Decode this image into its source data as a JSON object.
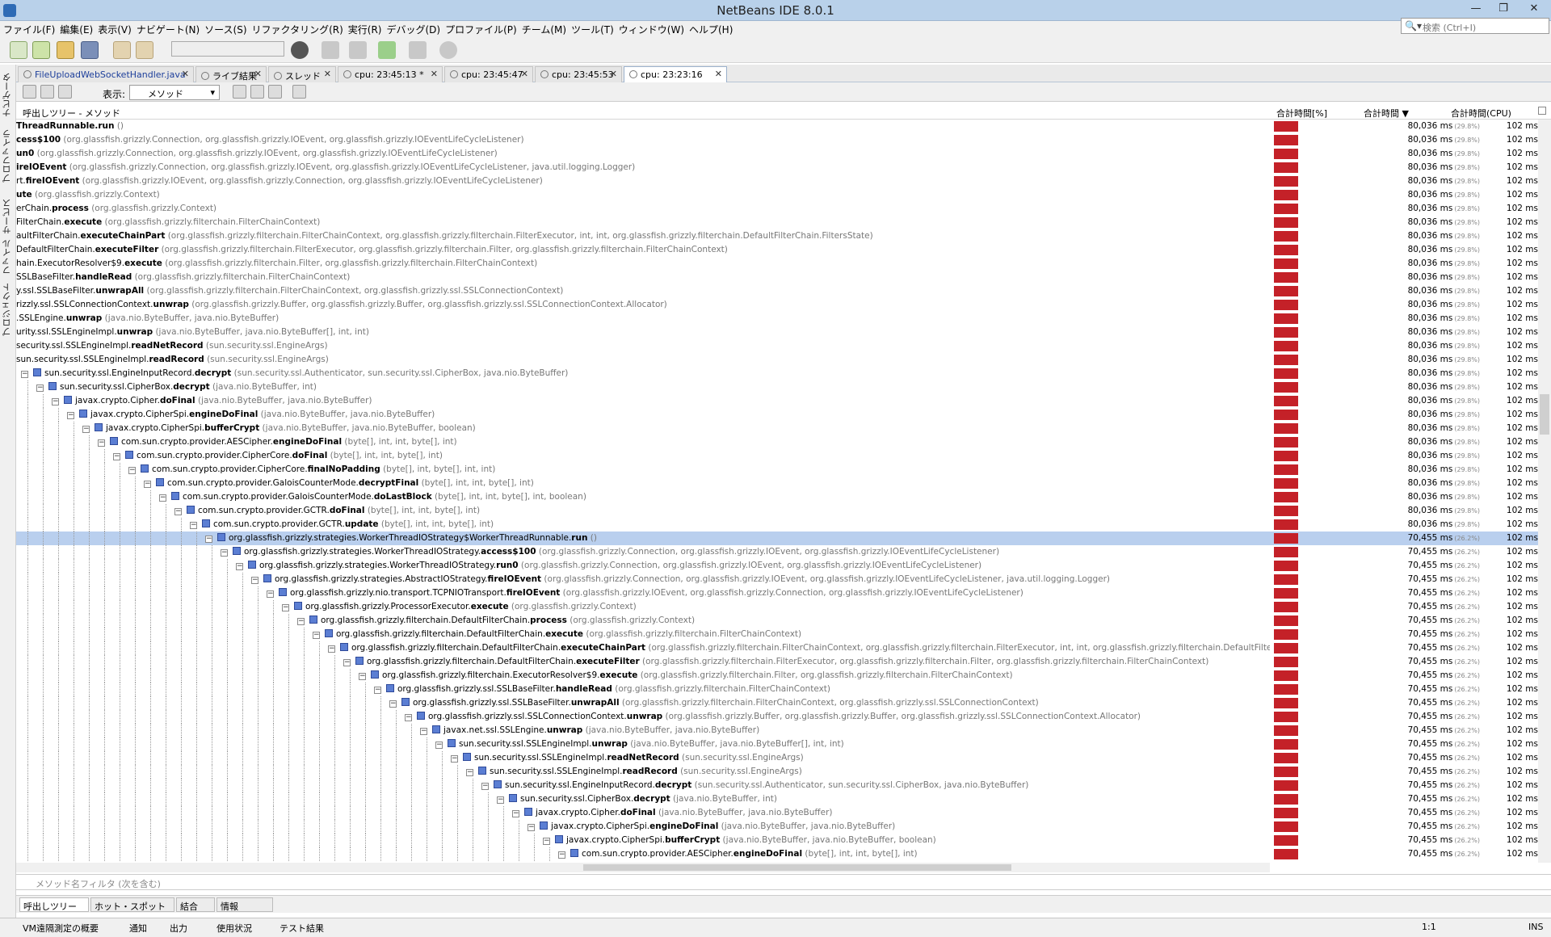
{
  "window": {
    "title": "NetBeans IDE 8.0.1"
  },
  "menu": [
    "ファイル(F)",
    "編集(E)",
    "表示(V)",
    "ナビゲート(N)",
    "ソース(S)",
    "リファクタリング(R)",
    "実行(R)",
    "デバッグ(D)",
    "プロファイル(P)",
    "チーム(M)",
    "ツール(T)",
    "ウィンドウ(W)",
    "ヘルプ(H)"
  ],
  "search": {
    "placeholder": "検索 (Ctrl+I)"
  },
  "left_tabs": [
    "ナビゲータ",
    "プロファイラ",
    "サービス",
    "ファイル",
    "プロジェクト"
  ],
  "tabs": [
    {
      "label": "FileUploadWebSocketHandler.java"
    },
    {
      "label": "ライブ結果"
    },
    {
      "label": "スレッド"
    },
    {
      "label": "cpu: 23:45:13 *"
    },
    {
      "label": "cpu: 23:45:47"
    },
    {
      "label": "cpu: 23:45:53"
    },
    {
      "label": "cpu: 23:23:16"
    }
  ],
  "profiler_toolbar": {
    "view_label": "表示:",
    "view_value": "メソッド"
  },
  "columns": {
    "tree": "呼出しツリー - メソッド",
    "total_bar": "合計時間[%]",
    "total_time": "合計時間",
    "total_cpu": "合計時間(CPU)"
  },
  "rows": [
    {
      "d": -1,
      "pkg": "",
      "m": "ThreadRunnable.run",
      "a": " ()",
      "t": "80,036 ms",
      "p": "(29.8%)",
      "c": "102 ms"
    },
    {
      "d": -1,
      "pkg": "",
      "m": "cess$100",
      "a": " (org.glassfish.grizzly.Connection, org.glassfish.grizzly.IOEvent, org.glassfish.grizzly.IOEventLifeCycleListener)",
      "t": "80,036 ms",
      "p": "(29.8%)",
      "c": "102 ms"
    },
    {
      "d": -1,
      "pkg": "",
      "m": "un0",
      "a": " (org.glassfish.grizzly.Connection, org.glassfish.grizzly.IOEvent, org.glassfish.grizzly.IOEventLifeCycleListener)",
      "t": "80,036 ms",
      "p": "(29.8%)",
      "c": "102 ms"
    },
    {
      "d": -1,
      "pkg": "",
      "m": "ireIOEvent",
      "a": " (org.glassfish.grizzly.Connection, org.glassfish.grizzly.IOEvent, org.glassfish.grizzly.IOEventLifeCycleListener, java.util.logging.Logger)",
      "t": "80,036 ms",
      "p": "(29.8%)",
      "c": "102 ms"
    },
    {
      "d": -1,
      "pkg": "rt.",
      "m": "fireIOEvent",
      "a": " (org.glassfish.grizzly.IOEvent, org.glassfish.grizzly.Connection, org.glassfish.grizzly.IOEventLifeCycleListener)",
      "t": "80,036 ms",
      "p": "(29.8%)",
      "c": "102 ms"
    },
    {
      "d": -1,
      "pkg": "",
      "m": "ute",
      "a": " (org.glassfish.grizzly.Context)",
      "t": "80,036 ms",
      "p": "(29.8%)",
      "c": "102 ms"
    },
    {
      "d": -1,
      "pkg": "erChain.",
      "m": "process",
      "a": " (org.glassfish.grizzly.Context)",
      "t": "80,036 ms",
      "p": "(29.8%)",
      "c": "102 ms"
    },
    {
      "d": -1,
      "pkg": "FilterChain.",
      "m": "execute",
      "a": " (org.glassfish.grizzly.filterchain.FilterChainContext)",
      "t": "80,036 ms",
      "p": "(29.8%)",
      "c": "102 ms"
    },
    {
      "d": -1,
      "pkg": "aultFilterChain.",
      "m": "executeChainPart",
      "a": " (org.glassfish.grizzly.filterchain.FilterChainContext, org.glassfish.grizzly.filterchain.FilterExecutor, int, int, org.glassfish.grizzly.filterchain.DefaultFilterChain.FiltersState)",
      "t": "80,036 ms",
      "p": "(29.8%)",
      "c": "102 ms"
    },
    {
      "d": -1,
      "pkg": "DefaultFilterChain.",
      "m": "executeFilter",
      "a": " (org.glassfish.grizzly.filterchain.FilterExecutor, org.glassfish.grizzly.filterchain.Filter, org.glassfish.grizzly.filterchain.FilterChainContext)",
      "t": "80,036 ms",
      "p": "(29.8%)",
      "c": "102 ms"
    },
    {
      "d": -1,
      "pkg": "hain.ExecutorResolver$9.",
      "m": "execute",
      "a": " (org.glassfish.grizzly.filterchain.Filter, org.glassfish.grizzly.filterchain.FilterChainContext)",
      "t": "80,036 ms",
      "p": "(29.8%)",
      "c": "102 ms"
    },
    {
      "d": -1,
      "pkg": "SSLBaseFilter.",
      "m": "handleRead",
      "a": " (org.glassfish.grizzly.filterchain.FilterChainContext)",
      "t": "80,036 ms",
      "p": "(29.8%)",
      "c": "102 ms"
    },
    {
      "d": -1,
      "pkg": "y.ssl.SSLBaseFilter.",
      "m": "unwrapAll",
      "a": " (org.glassfish.grizzly.filterchain.FilterChainContext, org.glassfish.grizzly.ssl.SSLConnectionContext)",
      "t": "80,036 ms",
      "p": "(29.8%)",
      "c": "102 ms"
    },
    {
      "d": -1,
      "pkg": "rizzly.ssl.SSLConnectionContext.",
      "m": "unwrap",
      "a": " (org.glassfish.grizzly.Buffer, org.glassfish.grizzly.Buffer, org.glassfish.grizzly.ssl.SSLConnectionContext.Allocator)",
      "t": "80,036 ms",
      "p": "(29.8%)",
      "c": "102 ms"
    },
    {
      "d": -1,
      "pkg": ".SSLEngine.",
      "m": "unwrap",
      "a": " (java.nio.ByteBuffer, java.nio.ByteBuffer)",
      "t": "80,036 ms",
      "p": "(29.8%)",
      "c": "102 ms"
    },
    {
      "d": -1,
      "pkg": "urity.ssl.SSLEngineImpl.",
      "m": "unwrap",
      "a": " (java.nio.ByteBuffer, java.nio.ByteBuffer[], int, int)",
      "t": "80,036 ms",
      "p": "(29.8%)",
      "c": "102 ms"
    },
    {
      "d": -1,
      "pkg": "security.ssl.SSLEngineImpl.",
      "m": "readNetRecord",
      "a": " (sun.security.ssl.EngineArgs)",
      "t": "80,036 ms",
      "p": "(29.8%)",
      "c": "102 ms"
    },
    {
      "d": -1,
      "pkg": "sun.security.ssl.SSLEngineImpl.",
      "m": "readRecord",
      "a": " (sun.security.ssl.EngineArgs)",
      "t": "80,036 ms",
      "p": "(29.8%)",
      "c": "102 ms"
    },
    {
      "d": 0,
      "pkg": "sun.security.ssl.EngineInputRecord.",
      "m": "decrypt",
      "a": " (sun.security.ssl.Authenticator, sun.security.ssl.CipherBox, java.nio.ByteBuffer)",
      "t": "80,036 ms",
      "p": "(29.8%)",
      "c": "102 ms"
    },
    {
      "d": 1,
      "pkg": "sun.security.ssl.CipherBox.",
      "m": "decrypt",
      "a": " (java.nio.ByteBuffer, int)",
      "t": "80,036 ms",
      "p": "(29.8%)",
      "c": "102 ms"
    },
    {
      "d": 2,
      "pkg": "javax.crypto.Cipher.",
      "m": "doFinal",
      "a": " (java.nio.ByteBuffer, java.nio.ByteBuffer)",
      "t": "80,036 ms",
      "p": "(29.8%)",
      "c": "102 ms"
    },
    {
      "d": 3,
      "pkg": "javax.crypto.CipherSpi.",
      "m": "engineDoFinal",
      "a": " (java.nio.ByteBuffer, java.nio.ByteBuffer)",
      "t": "80,036 ms",
      "p": "(29.8%)",
      "c": "102 ms"
    },
    {
      "d": 4,
      "pkg": "javax.crypto.CipherSpi.",
      "m": "bufferCrypt",
      "a": " (java.nio.ByteBuffer, java.nio.ByteBuffer, boolean)",
      "t": "80,036 ms",
      "p": "(29.8%)",
      "c": "102 ms"
    },
    {
      "d": 5,
      "pkg": "com.sun.crypto.provider.AESCipher.",
      "m": "engineDoFinal",
      "a": " (byte[], int, int, byte[], int)",
      "t": "80,036 ms",
      "p": "(29.8%)",
      "c": "102 ms"
    },
    {
      "d": 6,
      "pkg": "com.sun.crypto.provider.CipherCore.",
      "m": "doFinal",
      "a": " (byte[], int, int, byte[], int)",
      "t": "80,036 ms",
      "p": "(29.8%)",
      "c": "102 ms"
    },
    {
      "d": 7,
      "pkg": "com.sun.crypto.provider.CipherCore.",
      "m": "finalNoPadding",
      "a": " (byte[], int, byte[], int, int)",
      "t": "80,036 ms",
      "p": "(29.8%)",
      "c": "102 ms"
    },
    {
      "d": 8,
      "pkg": "com.sun.crypto.provider.GaloisCounterMode.",
      "m": "decryptFinal",
      "a": " (byte[], int, int, byte[], int)",
      "t": "80,036 ms",
      "p": "(29.8%)",
      "c": "102 ms"
    },
    {
      "d": 9,
      "pkg": "com.sun.crypto.provider.GaloisCounterMode.",
      "m": "doLastBlock",
      "a": " (byte[], int, int, byte[], int, boolean)",
      "t": "80,036 ms",
      "p": "(29.8%)",
      "c": "102 ms"
    },
    {
      "d": 10,
      "pkg": "com.sun.crypto.provider.GCTR.",
      "m": "doFinal",
      "a": " (byte[], int, int, byte[], int)",
      "t": "80,036 ms",
      "p": "(29.8%)",
      "c": "102 ms"
    },
    {
      "d": 11,
      "pkg": "com.sun.crypto.provider.GCTR.",
      "m": "update",
      "a": " (byte[], int, int, byte[], int)",
      "t": "80,036 ms",
      "p": "(29.8%)",
      "c": "102 ms"
    },
    {
      "d": 12,
      "pkg": "org.glassfish.grizzly.strategies.WorkerThreadIOStrategy$WorkerThreadRunnable.",
      "m": "run",
      "a": " ()",
      "t": "70,455 ms",
      "p": "(26.2%)",
      "c": "102 ms",
      "sel": true
    },
    {
      "d": 13,
      "pkg": "org.glassfish.grizzly.strategies.WorkerThreadIOStrategy.",
      "m": "access$100",
      "a": " (org.glassfish.grizzly.Connection, org.glassfish.grizzly.IOEvent, org.glassfish.grizzly.IOEventLifeCycleListener)",
      "t": "70,455 ms",
      "p": "(26.2%)",
      "c": "102 ms"
    },
    {
      "d": 14,
      "pkg": "org.glassfish.grizzly.strategies.WorkerThreadIOStrategy.",
      "m": "run0",
      "a": " (org.glassfish.grizzly.Connection, org.glassfish.grizzly.IOEvent, org.glassfish.grizzly.IOEventLifeCycleListener)",
      "t": "70,455 ms",
      "p": "(26.2%)",
      "c": "102 ms"
    },
    {
      "d": 15,
      "pkg": "org.glassfish.grizzly.strategies.AbstractIOStrategy.",
      "m": "fireIOEvent",
      "a": " (org.glassfish.grizzly.Connection, org.glassfish.grizzly.IOEvent, org.glassfish.grizzly.IOEventLifeCycleListener, java.util.logging.Logger)",
      "t": "70,455 ms",
      "p": "(26.2%)",
      "c": "102 ms"
    },
    {
      "d": 16,
      "pkg": "org.glassfish.grizzly.nio.transport.TCPNIOTransport.",
      "m": "fireIOEvent",
      "a": " (org.glassfish.grizzly.IOEvent, org.glassfish.grizzly.Connection, org.glassfish.grizzly.IOEventLifeCycleListener)",
      "t": "70,455 ms",
      "p": "(26.2%)",
      "c": "102 ms"
    },
    {
      "d": 17,
      "pkg": "org.glassfish.grizzly.ProcessorExecutor.",
      "m": "execute",
      "a": " (org.glassfish.grizzly.Context)",
      "t": "70,455 ms",
      "p": "(26.2%)",
      "c": "102 ms"
    },
    {
      "d": 18,
      "pkg": "org.glassfish.grizzly.filterchain.DefaultFilterChain.",
      "m": "process",
      "a": " (org.glassfish.grizzly.Context)",
      "t": "70,455 ms",
      "p": "(26.2%)",
      "c": "102 ms"
    },
    {
      "d": 19,
      "pkg": "org.glassfish.grizzly.filterchain.DefaultFilterChain.",
      "m": "execute",
      "a": " (org.glassfish.grizzly.filterchain.FilterChainContext)",
      "t": "70,455 ms",
      "p": "(26.2%)",
      "c": "102 ms"
    },
    {
      "d": 20,
      "pkg": "org.glassfish.grizzly.filterchain.DefaultFilterChain.",
      "m": "executeChainPart",
      "a": " (org.glassfish.grizzly.filterchain.FilterChainContext, org.glassfish.grizzly.filterchain.FilterExecutor, int, int, org.glassfish.grizzly.filterchain.DefaultFilterChain.Fil",
      "t": "70,455 ms",
      "p": "(26.2%)",
      "c": "102 ms"
    },
    {
      "d": 21,
      "pkg": "org.glassfish.grizzly.filterchain.DefaultFilterChain.",
      "m": "executeFilter",
      "a": " (org.glassfish.grizzly.filterchain.FilterExecutor, org.glassfish.grizzly.filterchain.Filter, org.glassfish.grizzly.filterchain.FilterChainContext)",
      "t": "70,455 ms",
      "p": "(26.2%)",
      "c": "102 ms"
    },
    {
      "d": 22,
      "pkg": "org.glassfish.grizzly.filterchain.ExecutorResolver$9.",
      "m": "execute",
      "a": " (org.glassfish.grizzly.filterchain.Filter, org.glassfish.grizzly.filterchain.FilterChainContext)",
      "t": "70,455 ms",
      "p": "(26.2%)",
      "c": "102 ms"
    },
    {
      "d": 23,
      "pkg": "org.glassfish.grizzly.ssl.SSLBaseFilter.",
      "m": "handleRead",
      "a": " (org.glassfish.grizzly.filterchain.FilterChainContext)",
      "t": "70,455 ms",
      "p": "(26.2%)",
      "c": "102 ms"
    },
    {
      "d": 24,
      "pkg": "org.glassfish.grizzly.ssl.SSLBaseFilter.",
      "m": "unwrapAll",
      "a": " (org.glassfish.grizzly.filterchain.FilterChainContext, org.glassfish.grizzly.ssl.SSLConnectionContext)",
      "t": "70,455 ms",
      "p": "(26.2%)",
      "c": "102 ms"
    },
    {
      "d": 25,
      "pkg": "org.glassfish.grizzly.ssl.SSLConnectionContext.",
      "m": "unwrap",
      "a": " (org.glassfish.grizzly.Buffer, org.glassfish.grizzly.Buffer, org.glassfish.grizzly.ssl.SSLConnectionContext.Allocator)",
      "t": "70,455 ms",
      "p": "(26.2%)",
      "c": "102 ms"
    },
    {
      "d": 26,
      "pkg": "javax.net.ssl.SSLEngine.",
      "m": "unwrap",
      "a": " (java.nio.ByteBuffer, java.nio.ByteBuffer)",
      "t": "70,455 ms",
      "p": "(26.2%)",
      "c": "102 ms"
    },
    {
      "d": 27,
      "pkg": "sun.security.ssl.SSLEngineImpl.",
      "m": "unwrap",
      "a": " (java.nio.ByteBuffer, java.nio.ByteBuffer[], int, int)",
      "t": "70,455 ms",
      "p": "(26.2%)",
      "c": "102 ms"
    },
    {
      "d": 28,
      "pkg": "sun.security.ssl.SSLEngineImpl.",
      "m": "readNetRecord",
      "a": " (sun.security.ssl.EngineArgs)",
      "t": "70,455 ms",
      "p": "(26.2%)",
      "c": "102 ms"
    },
    {
      "d": 29,
      "pkg": "sun.security.ssl.SSLEngineImpl.",
      "m": "readRecord",
      "a": " (sun.security.ssl.EngineArgs)",
      "t": "70,455 ms",
      "p": "(26.2%)",
      "c": "102 ms"
    },
    {
      "d": 30,
      "pkg": "sun.security.ssl.EngineInputRecord.",
      "m": "decrypt",
      "a": " (sun.security.ssl.Authenticator, sun.security.ssl.CipherBox, java.nio.ByteBuffer)",
      "t": "70,455 ms",
      "p": "(26.2%)",
      "c": "102 ms"
    },
    {
      "d": 31,
      "pkg": "sun.security.ssl.CipherBox.",
      "m": "decrypt",
      "a": " (java.nio.ByteBuffer, int)",
      "t": "70,455 ms",
      "p": "(26.2%)",
      "c": "102 ms"
    },
    {
      "d": 32,
      "pkg": "javax.crypto.Cipher.",
      "m": "doFinal",
      "a": " (java.nio.ByteBuffer, java.nio.ByteBuffer)",
      "t": "70,455 ms",
      "p": "(26.2%)",
      "c": "102 ms"
    },
    {
      "d": 33,
      "pkg": "javax.crypto.CipherSpi.",
      "m": "engineDoFinal",
      "a": " (java.nio.ByteBuffer, java.nio.ByteBuffer)",
      "t": "70,455 ms",
      "p": "(26.2%)",
      "c": "102 ms"
    },
    {
      "d": 34,
      "pkg": "javax.crypto.CipherSpi.",
      "m": "bufferCrypt",
      "a": " (java.nio.ByteBuffer, java.nio.ByteBuffer, boolean)",
      "t": "70,455 ms",
      "p": "(26.2%)",
      "c": "102 ms"
    },
    {
      "d": 35,
      "pkg": "com.sun.crypto.provider.AESCipher.",
      "m": "engineDoFinal",
      "a": " (byte[], int, int, byte[], int)",
      "t": "70,455 ms",
      "p": "(26.2%)",
      "c": "102 ms"
    }
  ],
  "filter": {
    "placeholder": "メソッド名フィルタ (次を含む)"
  },
  "bottom_tabs": [
    "呼出しツリー",
    "ホット・スポット",
    "結合",
    "情報"
  ],
  "status": {
    "items": [
      "VM遠隔測定の概要",
      "通知",
      "出力",
      "使用状況",
      "テスト結果"
    ],
    "position": "1:1",
    "mode": "INS"
  }
}
